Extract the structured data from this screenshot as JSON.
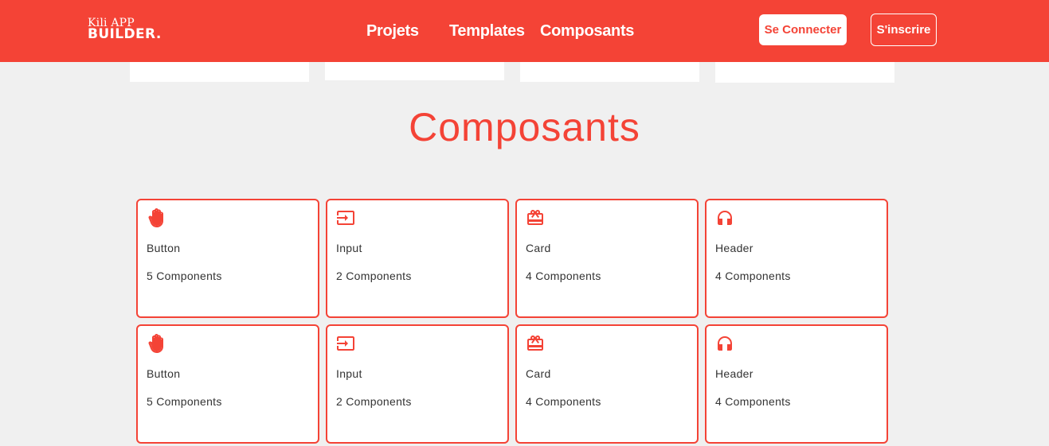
{
  "header": {
    "logo_line1": "Kili APP",
    "logo_line2": "BUILDER.",
    "nav": [
      "Projets",
      "Templates",
      "Composants"
    ],
    "login_label": "Se Connecter",
    "signup_label": "S'inscrire"
  },
  "colors": {
    "accent": "#f44336",
    "background": "#f0f0f0",
    "card_bg": "#ffffff",
    "text": "#333333"
  },
  "section": {
    "title": "Composants"
  },
  "cards": [
    {
      "icon": "hand-icon",
      "name": "Button",
      "count": "5 Components"
    },
    {
      "icon": "input-icon",
      "name": "Input",
      "count": "2 Components"
    },
    {
      "icon": "card-icon",
      "name": "Card",
      "count": "4 Components"
    },
    {
      "icon": "headphones-icon",
      "name": "Header",
      "count": "4 Components"
    },
    {
      "icon": "hand-icon",
      "name": "Button",
      "count": "5 Components"
    },
    {
      "icon": "input-icon",
      "name": "Input",
      "count": "2 Components"
    },
    {
      "icon": "card-icon",
      "name": "Card",
      "count": "4 Components"
    },
    {
      "icon": "headphones-icon",
      "name": "Header",
      "count": "4 Components"
    }
  ]
}
